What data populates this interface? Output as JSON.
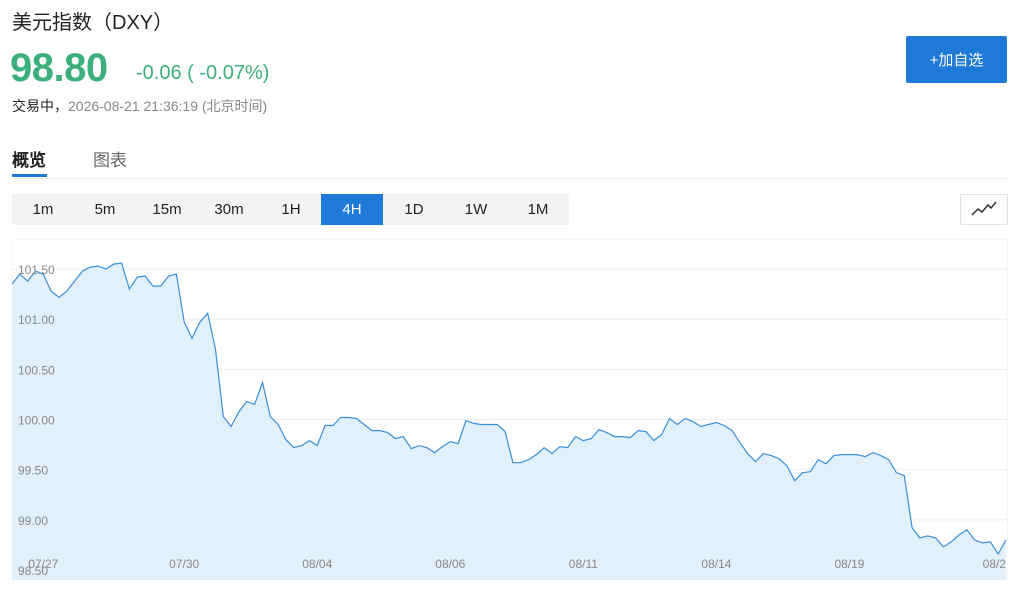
{
  "header": {
    "title": "美元指数（DXY）",
    "price": "98.80",
    "change": "-0.06",
    "change_pct": "( -0.07%)",
    "status_label": "交易中，",
    "timestamp": "2026-08-21 21:36:19 (北京时间)"
  },
  "watch_button": {
    "label": "+加自选"
  },
  "tabs": [
    {
      "label": "概览",
      "active": true
    },
    {
      "label": "图表",
      "active": false
    }
  ],
  "periods": [
    {
      "label": "1m"
    },
    {
      "label": "5m"
    },
    {
      "label": "15m"
    },
    {
      "label": "30m"
    },
    {
      "label": "1H"
    },
    {
      "label": "4H",
      "active": true
    },
    {
      "label": "1D"
    },
    {
      "label": "1W"
    },
    {
      "label": "1M"
    }
  ],
  "chart_type_icon": "line-chart-icon",
  "colors": {
    "up_green": "#3cb07c",
    "accent_blue": "#1e7ad6",
    "line": "#3a8ed8",
    "area_fill": "#e2f0fc"
  },
  "chart_data": {
    "type": "area",
    "title": "",
    "xlabel": "",
    "ylabel": "",
    "ylim": [
      98.4,
      101.8
    ],
    "y_ticks": [
      98.5,
      99.0,
      99.5,
      100.0,
      100.5,
      101.0,
      101.5
    ],
    "y_tick_labels": [
      "98.50",
      "99.00",
      "99.50",
      "100.00",
      "100.50",
      "101.00",
      "101.50"
    ],
    "x_tick_labels": [
      "07/27",
      "07/30",
      "08/04",
      "08/06",
      "08/11",
      "08/14",
      "08/19",
      "08/2"
    ],
    "x_tick_index": [
      4,
      22,
      39,
      56,
      73,
      90,
      107,
      124
    ],
    "grid": true,
    "values": [
      101.35,
      101.45,
      101.38,
      101.48,
      101.45,
      101.28,
      101.22,
      101.28,
      101.38,
      101.48,
      101.52,
      101.53,
      101.5,
      101.55,
      101.56,
      101.3,
      101.42,
      101.43,
      101.33,
      101.33,
      101.43,
      101.45,
      100.97,
      100.81,
      100.97,
      101.06,
      100.7,
      100.03,
      99.93,
      100.08,
      100.18,
      100.15,
      100.37,
      100.03,
      99.95,
      99.8,
      99.72,
      99.74,
      99.79,
      99.74,
      99.94,
      99.94,
      100.02,
      100.02,
      100.01,
      99.95,
      99.89,
      99.89,
      99.87,
      99.81,
      99.83,
      99.71,
      99.74,
      99.72,
      99.67,
      99.73,
      99.78,
      99.76,
      99.99,
      99.96,
      99.95,
      99.95,
      99.95,
      99.88,
      99.57,
      99.57,
      99.6,
      99.65,
      99.72,
      99.66,
      99.73,
      99.72,
      99.83,
      99.79,
      99.81,
      99.9,
      99.87,
      99.83,
      99.83,
      99.82,
      99.89,
      99.88,
      99.79,
      99.85,
      100.01,
      99.95,
      100.01,
      99.98,
      99.93,
      99.95,
      99.97,
      99.94,
      99.89,
      99.77,
      99.66,
      99.58,
      99.66,
      99.64,
      99.61,
      99.54,
      99.39,
      99.47,
      99.48,
      99.6,
      99.56,
      99.64,
      99.65,
      99.65,
      99.65,
      99.63,
      99.67,
      99.64,
      99.6,
      99.47,
      99.44,
      98.92,
      98.82,
      98.84,
      98.82,
      98.73,
      98.78,
      98.85,
      98.9,
      98.8,
      98.77,
      98.78,
      98.66,
      98.8
    ]
  }
}
